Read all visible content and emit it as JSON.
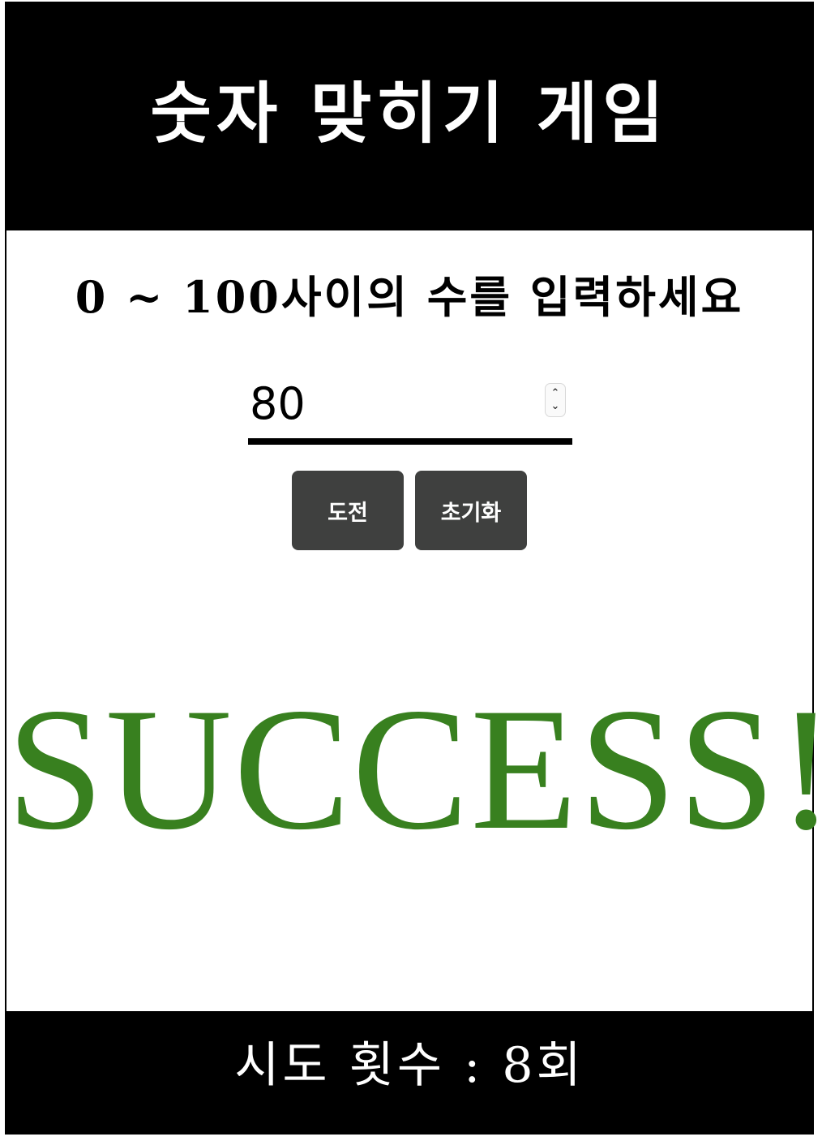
{
  "header": {
    "title": "숫자 맞히기 게임"
  },
  "main": {
    "instruction": "0 ~ 100사이의 수를 입력하세요",
    "input": {
      "value": "80"
    },
    "buttons": {
      "challenge_label": "도전",
      "reset_label": "초기화"
    },
    "result": {
      "text": "SUCCESS!",
      "color": "#38801f"
    }
  },
  "footer": {
    "attempts_text": "시도 횟수 : 8회"
  },
  "icons": {
    "spinner_up": "chevron-up-icon",
    "spinner_down": "chevron-down-icon"
  }
}
